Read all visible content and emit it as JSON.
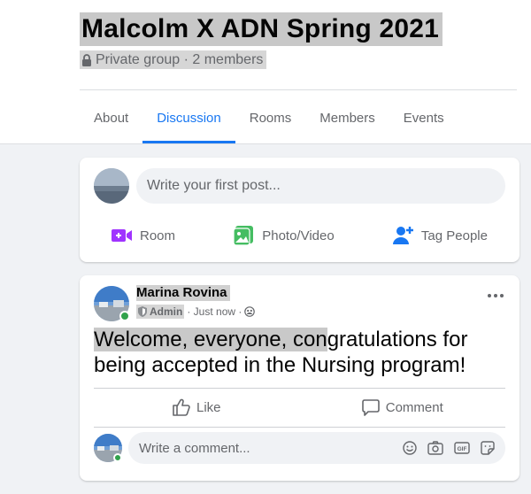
{
  "group": {
    "title": "Malcolm X ADN Spring 2021",
    "meta": "Private group · 2 members"
  },
  "tabs": [
    {
      "label": "About",
      "active": false
    },
    {
      "label": "Discussion",
      "active": true
    },
    {
      "label": "Rooms",
      "active": false
    },
    {
      "label": "Members",
      "active": false
    },
    {
      "label": "Events",
      "active": false
    }
  ],
  "composer": {
    "placeholder": "Write your first post...",
    "actions": [
      {
        "label": "Room",
        "icon": "video-room-icon",
        "color": "#a033ff"
      },
      {
        "label": "Photo/Video",
        "icon": "photo-icon",
        "color": "#45bd62"
      },
      {
        "label": "Tag People",
        "icon": "tag-people-icon",
        "color": "#1877f2"
      }
    ]
  },
  "post": {
    "author": "Marina Rovina",
    "role": "Admin",
    "time": "· Just now ·",
    "text_highlighted": "Welcome, everyone, con",
    "text_rest": "gratulations for being accepted in the Nursing program!",
    "like_label": "Like",
    "comment_label": "Comment",
    "comment_placeholder": "Write a comment..."
  },
  "colors": {
    "accent": "#1877f2",
    "online": "#31a24c"
  }
}
